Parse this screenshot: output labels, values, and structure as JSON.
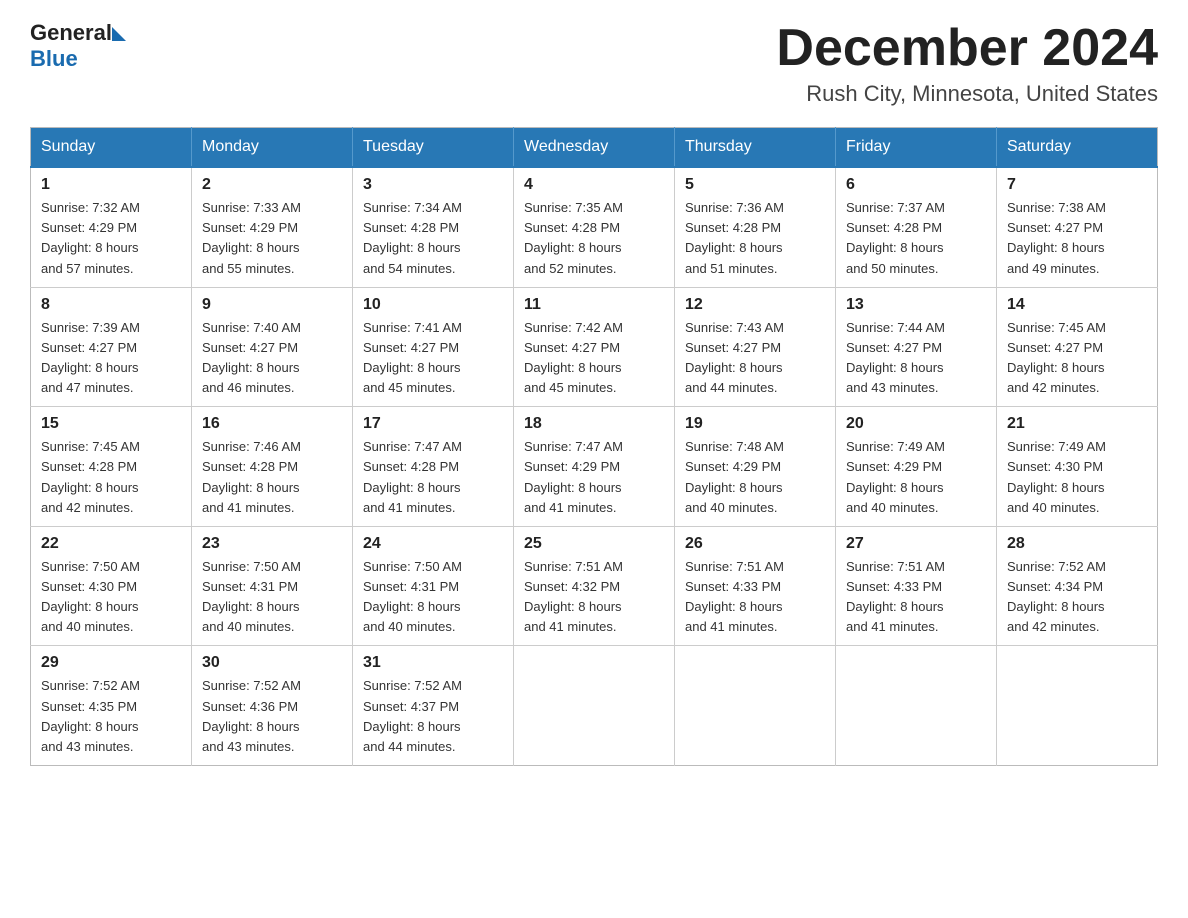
{
  "header": {
    "logo": {
      "general": "General",
      "triangle": "",
      "blue": "Blue"
    },
    "month_title": "December 2024",
    "location": "Rush City, Minnesota, United States"
  },
  "days_of_week": [
    "Sunday",
    "Monday",
    "Tuesday",
    "Wednesday",
    "Thursday",
    "Friday",
    "Saturday"
  ],
  "weeks": [
    [
      {
        "day": "1",
        "sunrise": "7:32 AM",
        "sunset": "4:29 PM",
        "daylight": "8 hours and 57 minutes."
      },
      {
        "day": "2",
        "sunrise": "7:33 AM",
        "sunset": "4:29 PM",
        "daylight": "8 hours and 55 minutes."
      },
      {
        "day": "3",
        "sunrise": "7:34 AM",
        "sunset": "4:28 PM",
        "daylight": "8 hours and 54 minutes."
      },
      {
        "day": "4",
        "sunrise": "7:35 AM",
        "sunset": "4:28 PM",
        "daylight": "8 hours and 52 minutes."
      },
      {
        "day": "5",
        "sunrise": "7:36 AM",
        "sunset": "4:28 PM",
        "daylight": "8 hours and 51 minutes."
      },
      {
        "day": "6",
        "sunrise": "7:37 AM",
        "sunset": "4:28 PM",
        "daylight": "8 hours and 50 minutes."
      },
      {
        "day": "7",
        "sunrise": "7:38 AM",
        "sunset": "4:27 PM",
        "daylight": "8 hours and 49 minutes."
      }
    ],
    [
      {
        "day": "8",
        "sunrise": "7:39 AM",
        "sunset": "4:27 PM",
        "daylight": "8 hours and 47 minutes."
      },
      {
        "day": "9",
        "sunrise": "7:40 AM",
        "sunset": "4:27 PM",
        "daylight": "8 hours and 46 minutes."
      },
      {
        "day": "10",
        "sunrise": "7:41 AM",
        "sunset": "4:27 PM",
        "daylight": "8 hours and 45 minutes."
      },
      {
        "day": "11",
        "sunrise": "7:42 AM",
        "sunset": "4:27 PM",
        "daylight": "8 hours and 45 minutes."
      },
      {
        "day": "12",
        "sunrise": "7:43 AM",
        "sunset": "4:27 PM",
        "daylight": "8 hours and 44 minutes."
      },
      {
        "day": "13",
        "sunrise": "7:44 AM",
        "sunset": "4:27 PM",
        "daylight": "8 hours and 43 minutes."
      },
      {
        "day": "14",
        "sunrise": "7:45 AM",
        "sunset": "4:27 PM",
        "daylight": "8 hours and 42 minutes."
      }
    ],
    [
      {
        "day": "15",
        "sunrise": "7:45 AM",
        "sunset": "4:28 PM",
        "daylight": "8 hours and 42 minutes."
      },
      {
        "day": "16",
        "sunrise": "7:46 AM",
        "sunset": "4:28 PM",
        "daylight": "8 hours and 41 minutes."
      },
      {
        "day": "17",
        "sunrise": "7:47 AM",
        "sunset": "4:28 PM",
        "daylight": "8 hours and 41 minutes."
      },
      {
        "day": "18",
        "sunrise": "7:47 AM",
        "sunset": "4:29 PM",
        "daylight": "8 hours and 41 minutes."
      },
      {
        "day": "19",
        "sunrise": "7:48 AM",
        "sunset": "4:29 PM",
        "daylight": "8 hours and 40 minutes."
      },
      {
        "day": "20",
        "sunrise": "7:49 AM",
        "sunset": "4:29 PM",
        "daylight": "8 hours and 40 minutes."
      },
      {
        "day": "21",
        "sunrise": "7:49 AM",
        "sunset": "4:30 PM",
        "daylight": "8 hours and 40 minutes."
      }
    ],
    [
      {
        "day": "22",
        "sunrise": "7:50 AM",
        "sunset": "4:30 PM",
        "daylight": "8 hours and 40 minutes."
      },
      {
        "day": "23",
        "sunrise": "7:50 AM",
        "sunset": "4:31 PM",
        "daylight": "8 hours and 40 minutes."
      },
      {
        "day": "24",
        "sunrise": "7:50 AM",
        "sunset": "4:31 PM",
        "daylight": "8 hours and 40 minutes."
      },
      {
        "day": "25",
        "sunrise": "7:51 AM",
        "sunset": "4:32 PM",
        "daylight": "8 hours and 41 minutes."
      },
      {
        "day": "26",
        "sunrise": "7:51 AM",
        "sunset": "4:33 PM",
        "daylight": "8 hours and 41 minutes."
      },
      {
        "day": "27",
        "sunrise": "7:51 AM",
        "sunset": "4:33 PM",
        "daylight": "8 hours and 41 minutes."
      },
      {
        "day": "28",
        "sunrise": "7:52 AM",
        "sunset": "4:34 PM",
        "daylight": "8 hours and 42 minutes."
      }
    ],
    [
      {
        "day": "29",
        "sunrise": "7:52 AM",
        "sunset": "4:35 PM",
        "daylight": "8 hours and 43 minutes."
      },
      {
        "day": "30",
        "sunrise": "7:52 AM",
        "sunset": "4:36 PM",
        "daylight": "8 hours and 43 minutes."
      },
      {
        "day": "31",
        "sunrise": "7:52 AM",
        "sunset": "4:37 PM",
        "daylight": "8 hours and 44 minutes."
      },
      null,
      null,
      null,
      null
    ]
  ],
  "labels": {
    "sunrise": "Sunrise:",
    "sunset": "Sunset:",
    "daylight": "Daylight:"
  }
}
